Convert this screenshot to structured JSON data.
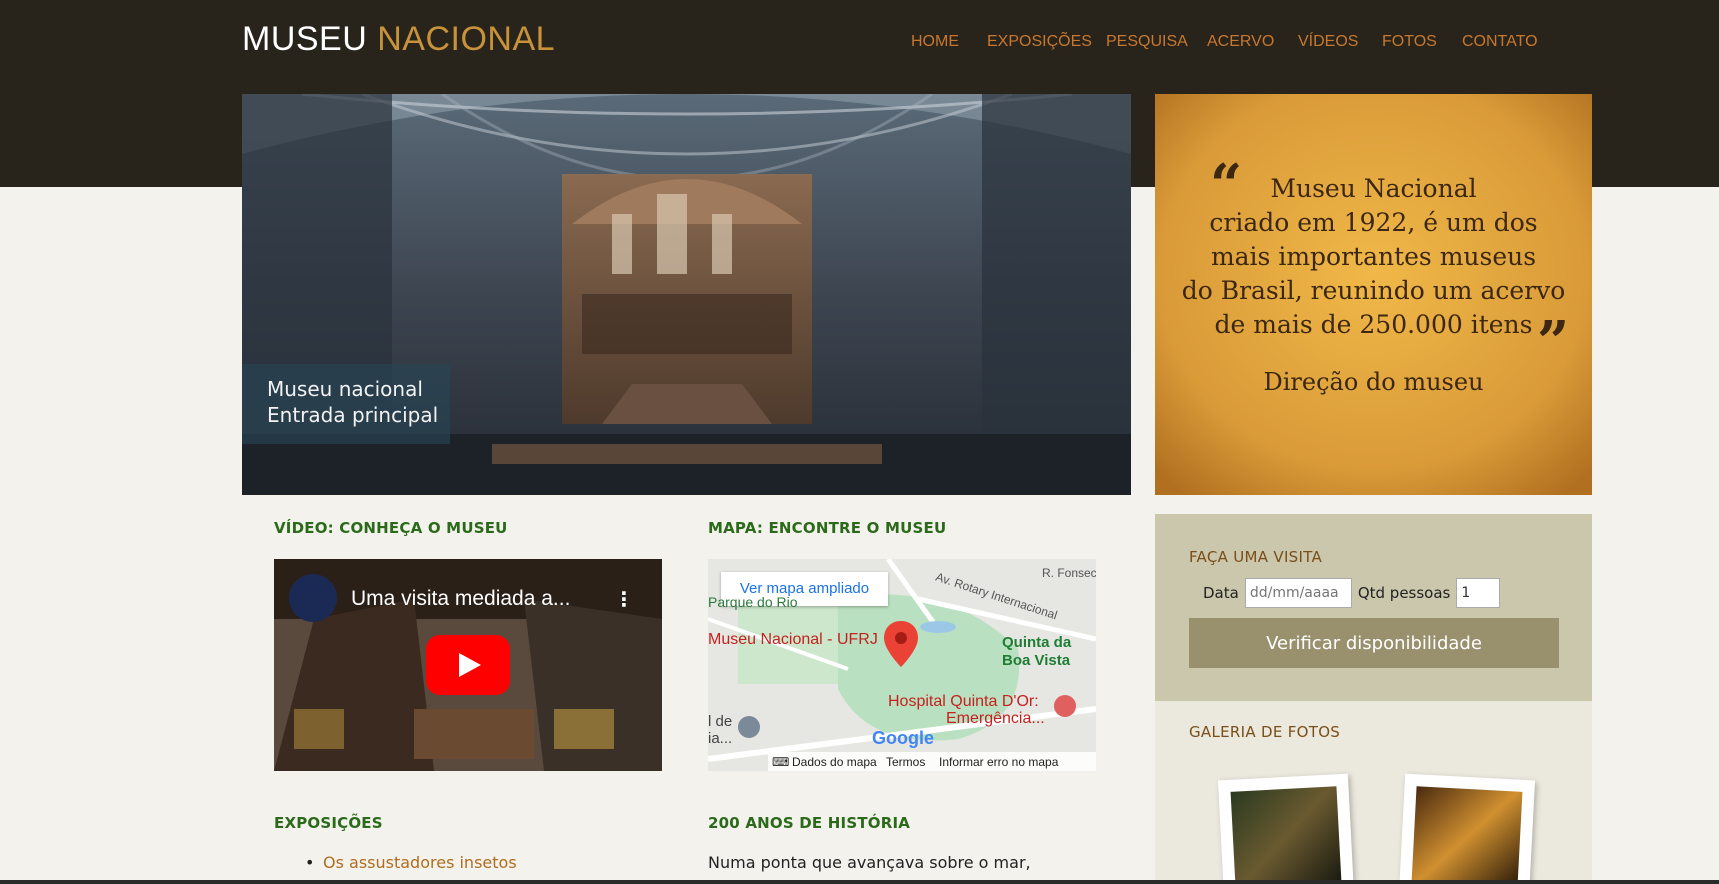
{
  "header": {
    "logo_part1": "MUSEU",
    "logo_part2": "NACIONAL",
    "nav": [
      "HOME",
      "EXPOSIÇÕES",
      "PESQUISA",
      "ACERVO",
      "VÍDEOS",
      "FOTOS",
      "CONTATO"
    ]
  },
  "hero": {
    "caption_line1": "Museu nacional",
    "caption_line2": "Entrada principal"
  },
  "quote": {
    "open_mark": "“",
    "close_mark": "”",
    "lines": [
      "Museu Nacional",
      "criado em 1922, é um dos",
      "mais importantes museus",
      "do Brasil, reunindo um acervo",
      "de mais de 250.000 itens"
    ],
    "signature": "Direção do museu"
  },
  "visit": {
    "title": "FAÇA UMA VISITA",
    "date_label": "Data",
    "date_placeholder": "dd/mm/aaaa",
    "qty_label": "Qtd pessoas",
    "qty_value": "1",
    "button": "Verificar disponibilidade"
  },
  "gallery": {
    "title": "GALERIA DE FOTOS"
  },
  "video_section": {
    "title": "VÍDEO: CONHEÇA O MUSEU",
    "video_title": "Uma visita mediada a...",
    "channel_icon": "museu-nacional-logo-icon"
  },
  "map_section": {
    "title": "MAPA: ENCONTRE O MUSEU",
    "open_larger": "Ver mapa ampliado",
    "labels": {
      "fonseca": "R. Fonsec",
      "parque": "Parque do Rio",
      "rotary": "Av. Rotary Internacional",
      "museu": "Museu Nacional - UFRJ",
      "quinta1": "Quinta da",
      "quinta2": "Boa Vista",
      "hospital1": "Hospital Quinta D'Or:",
      "hospital2": "Emergência...",
      "left1": "l de",
      "left2": "ia...",
      "google": "Google"
    },
    "footer": {
      "data": "Dados do mapa",
      "terms": "Termos",
      "report": "Informar erro no mapa"
    }
  },
  "exposicoes": {
    "title": "EXPOSIÇÕES",
    "items": [
      "Os assustadores insetos"
    ]
  },
  "historia": {
    "title": "200 ANOS DE HISTÓRIA",
    "text": "Numa ponta que avançava sobre o mar,"
  },
  "colors": {
    "header_bg": "#28241b",
    "nav": "#c8782e",
    "accent_gold": "#c8923a",
    "section_title": "#2b6a1b",
    "visit_bg": "#cbc7ad",
    "button_bg": "#99916d"
  }
}
